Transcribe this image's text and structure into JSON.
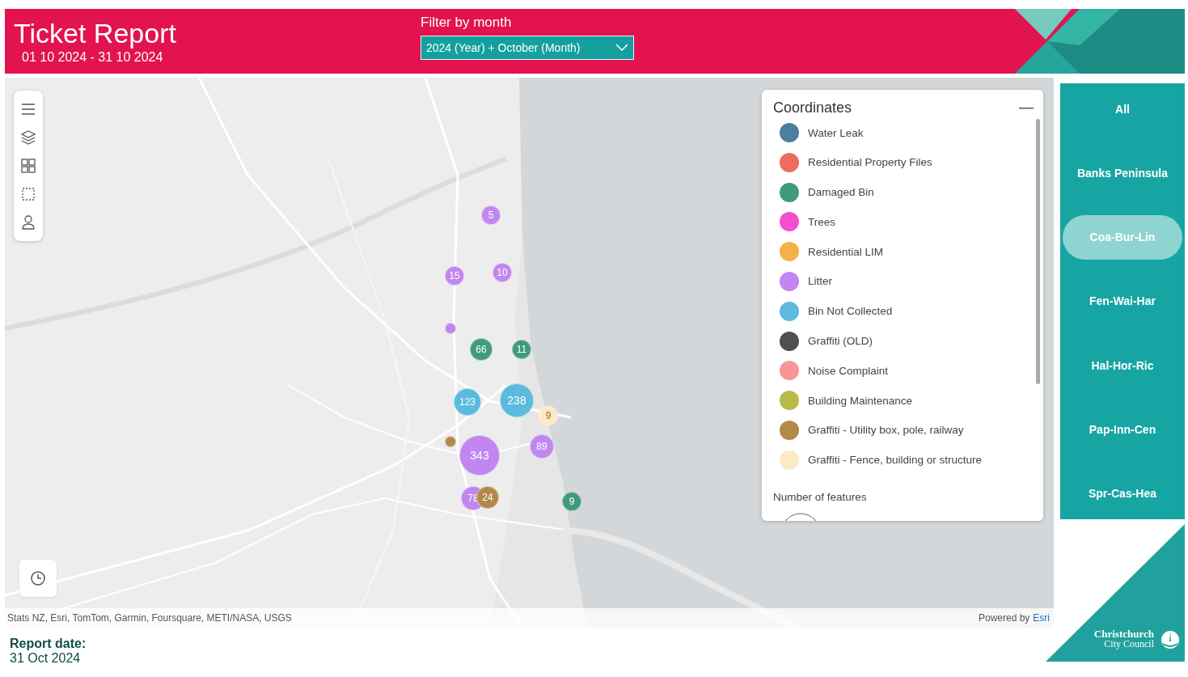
{
  "header": {
    "title": "Ticket Report",
    "date_range": "01 10 2024 - 31 10 2024",
    "filter": {
      "label": "Filter by month",
      "value": "2024 (Year) + October (Month)"
    }
  },
  "map": {
    "clusters": [
      {
        "count": "5",
        "color": "#c186f0"
      },
      {
        "count": "15",
        "color": "#c186f0"
      },
      {
        "count": "10",
        "color": "#c186f0"
      },
      {
        "color": "#c186f0"
      },
      {
        "count": "66",
        "color": "#3f9b7c"
      },
      {
        "count": "11",
        "color": "#3f9b7c"
      },
      {
        "count": "123",
        "color": "#5bbadd"
      },
      {
        "count": "238",
        "color": "#5bbadd"
      },
      {
        "count": "9",
        "color": "#fde9c3"
      },
      {
        "color": "#b3894a"
      },
      {
        "count": "343",
        "color": "#c186f0"
      },
      {
        "count": "89",
        "color": "#c186f0"
      },
      {
        "count": "78",
        "color": "#c186f0"
      },
      {
        "count": "24",
        "color": "#b3894a"
      },
      {
        "count": "9",
        "color": "#3f9b7c"
      }
    ],
    "attribution": "Stats NZ, Esri, TomTom, Garmin, Foursquare, METI/NASA, USGS",
    "powered_by": "Powered by",
    "powered_link": "Esri"
  },
  "legend": {
    "title": "Coordinates",
    "items": [
      {
        "label": "Water Leak",
        "color": "#4a7fa0"
      },
      {
        "label": "Residential Property Files",
        "color": "#ee6b5f"
      },
      {
        "label": "Damaged Bin",
        "color": "#3f9b7c"
      },
      {
        "label": "Trees",
        "color": "#f54fd0"
      },
      {
        "label": "Residential LIM",
        "color": "#f5b04a"
      },
      {
        "label": "Litter",
        "color": "#c186f0"
      },
      {
        "label": "Bin Not Collected",
        "color": "#5bbadd"
      },
      {
        "label": "Graffiti (OLD)",
        "color": "#505050"
      },
      {
        "label": "Noise Complaint",
        "color": "#f99497"
      },
      {
        "label": "Building Maintenance",
        "color": "#b9b94a"
      },
      {
        "label": "Graffiti - Utility box, pole, railway",
        "color": "#b3894a"
      },
      {
        "label": "Graffiti - Fence, building or structure",
        "color": "#fde9c3"
      }
    ],
    "size_title": "Number of features"
  },
  "areas": [
    {
      "label": "All",
      "selected": false
    },
    {
      "label": "Banks Peninsula",
      "selected": false
    },
    {
      "label": "Coa-Bur-Lin",
      "selected": true
    },
    {
      "label": "Fen-Wai-Har",
      "selected": false
    },
    {
      "label": "Hal-Hor-Ric",
      "selected": false
    },
    {
      "label": "Pap-Inn-Cen",
      "selected": false
    },
    {
      "label": "Spr-Cas-Hea",
      "selected": false
    }
  ],
  "logo": {
    "line1": "Christchurch",
    "line2": "City Council"
  },
  "footer": {
    "label": "Report date:",
    "date": "31 Oct 2024"
  }
}
